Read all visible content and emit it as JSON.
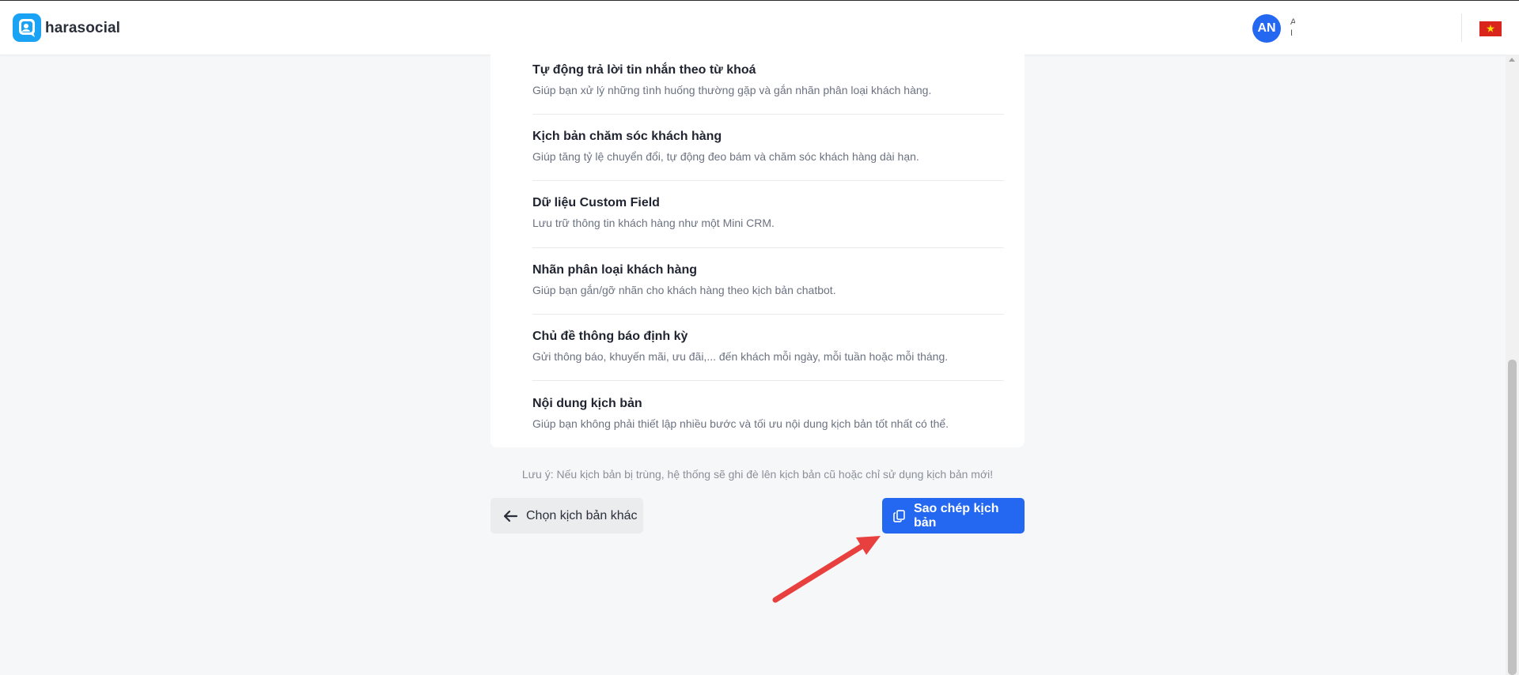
{
  "header": {
    "brand": "harasocial",
    "avatar_initials": "AN",
    "user_line1": "A",
    "user_line2": "I"
  },
  "features": [
    {
      "title": "Tự động trả lời tin nhắn theo từ khoá",
      "desc": "Giúp bạn xử lý những tình huống thường gặp và gắn nhãn phân loại khách hàng."
    },
    {
      "title": "Kịch bản chăm sóc khách hàng",
      "desc": "Giúp tăng tỷ lệ chuyển đổi, tự động đeo bám và chăm sóc khách hàng dài hạn."
    },
    {
      "title": "Dữ liệu Custom Field",
      "desc": "Lưu trữ thông tin khách hàng như một Mini CRM."
    },
    {
      "title": "Nhãn phân loại khách hàng",
      "desc": "Giúp bạn gắn/gỡ nhãn cho khách hàng theo kịch bản chatbot."
    },
    {
      "title": "Chủ đề thông báo định kỳ",
      "desc": "Gửi thông báo, khuyến mãi, ưu đãi,... đến khách mỗi ngày, mỗi tuần hoặc mỗi tháng."
    },
    {
      "title": "Nội dung kịch bản",
      "desc": "Giúp bạn không phải thiết lập nhiều bước và tối ưu nội dung kịch bản tốt nhất có thể."
    }
  ],
  "note": "Lưu ý: Nếu kịch bản bị trùng, hệ thống sẽ ghi đè lên kịch bản cũ hoặc chỉ sử dụng kịch bản mới!",
  "actions": {
    "back_label": "Chọn kịch bản khác",
    "copy_label": "Sao chép kịch bản"
  },
  "colors": {
    "primary": "#2468f2",
    "logo": "#1aa3f5",
    "annotation_arrow": "#e8403f"
  },
  "icons": {
    "back": "arrow-left-icon",
    "copy": "copy-icon",
    "flag": "vietnam-flag-icon"
  }
}
